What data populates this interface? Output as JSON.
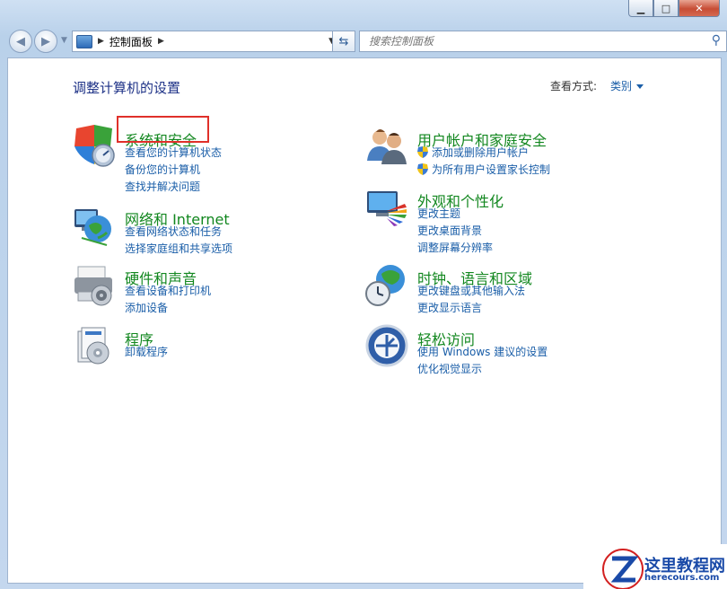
{
  "window": {
    "controls": {
      "minimize": "▁",
      "maximize": "□",
      "close": "✕"
    }
  },
  "navigation": {
    "back_icon": "back-arrow-icon",
    "forward_icon": "forward-arrow-icon",
    "address": {
      "crumb": "控制面板"
    },
    "search": {
      "placeholder": "搜索控制面板"
    }
  },
  "main": {
    "heading": "调整计算机的设置",
    "view_by": {
      "label": "查看方式:",
      "value": "类别"
    }
  },
  "categories": [
    {
      "title": "系统和安全",
      "icon": "system-security-icon",
      "links": [
        "查看您的计算机状态",
        "备份您的计算机",
        "查找并解决问题"
      ]
    },
    {
      "title": "网络和 Internet",
      "icon": "network-internet-icon",
      "links": [
        "查看网络状态和任务",
        "选择家庭组和共享选项"
      ]
    },
    {
      "title": "硬件和声音",
      "icon": "hardware-sound-icon",
      "links": [
        "查看设备和打印机",
        "添加设备"
      ]
    },
    {
      "title": "程序",
      "icon": "programs-icon",
      "links": [
        "卸载程序"
      ]
    },
    {
      "title": "用户帐户和家庭安全",
      "icon": "user-accounts-icon",
      "links": [
        "添加或删除用户帐户",
        "为所有用户设置家长控制"
      ]
    },
    {
      "title": "外观和个性化",
      "icon": "appearance-icon",
      "links": [
        "更改主题",
        "更改桌面背景",
        "调整屏幕分辨率"
      ]
    },
    {
      "title": "时钟、语言和区域",
      "icon": "clock-language-icon",
      "links": [
        "更改键盘或其他输入法",
        "更改显示语言"
      ]
    },
    {
      "title": "轻松访问",
      "icon": "ease-of-access-icon",
      "links": [
        "使用 Windows 建议的设置",
        "优化视觉显示"
      ]
    }
  ],
  "watermark": {
    "title": "这里教程网",
    "url": "herecours.com"
  }
}
